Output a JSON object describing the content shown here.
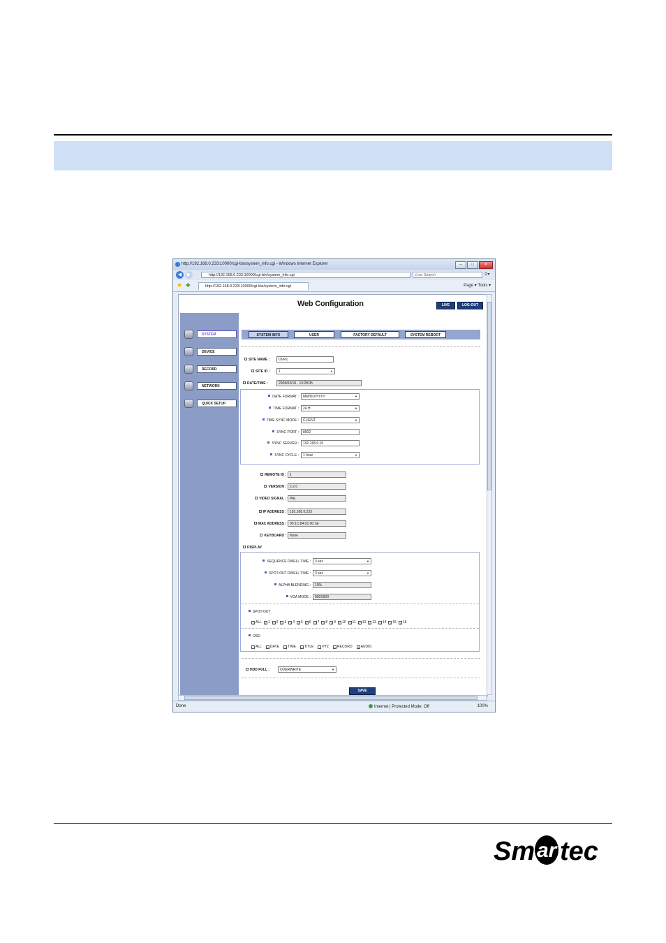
{
  "browser": {
    "title": "http://192.168.0.233:10000/cgi-bin/system_info.cgi - Windows Internet Explorer",
    "window_buttons": [
      "–",
      "□",
      "✕"
    ],
    "address": "http://192.168.0.233:10000/cgi-bin/system_info.cgi",
    "search_placeholder": "Live Search",
    "tab_title": "http://192.168.0.233:10000/cgi-bin/system_info.cgi",
    "tools_text": "Page ▾  Tools ▾",
    "status_left": "Done",
    "status_zone": "Internet | Protected Mode: Off",
    "status_zoom": "100%"
  },
  "app": {
    "title": "Web Configuration",
    "live_label": "LIVE",
    "logout_label": "LOG-OUT",
    "sidebar": [
      {
        "label": "SYSTEM",
        "active": true,
        "icon": "camera-icon"
      },
      {
        "label": "DEVICE",
        "active": false,
        "icon": "device-icon"
      },
      {
        "label": "RECORD",
        "active": false,
        "icon": "record-icon"
      },
      {
        "label": "NETWORK",
        "active": false,
        "icon": "network-icon"
      },
      {
        "label": "QUICK SETUP",
        "active": false,
        "icon": "quick-setup-icon"
      }
    ],
    "tabs": [
      "SYSTEM INFO",
      "USER",
      "FACTORY DEFAULT",
      "SYSTEM REBOOT"
    ],
    "fields": {
      "site_name": {
        "label": "SITE NAME :",
        "value": "DVR1"
      },
      "site_id": {
        "label": "SITE ID :",
        "value": "1"
      },
      "date_time": {
        "label": "DATE/TIME :",
        "value": "2008/03/18 - 13:28:05"
      },
      "date_format": {
        "label": "DATE FORMAT :",
        "value": "MM/DD/YYYY"
      },
      "time_format": {
        "label": "TIME FORMAT :",
        "value": "24 H"
      },
      "time_sync_mode": {
        "label": "TIME SYNC MODE :",
        "value": "CLIENT"
      },
      "sync_port": {
        "label": "SYNC PORT :",
        "value": "8002"
      },
      "sync_server": {
        "label": "SYNC SERVER :",
        "value": "192.168.0.15"
      },
      "sync_cycle": {
        "label": "SYNC CYCLE :",
        "value": "1 hour"
      },
      "remote_id": {
        "label": "REMOTE ID :",
        "value": "1"
      },
      "version": {
        "label": "VERSION :",
        "value": "2.2.0"
      },
      "video_signal": {
        "label": "VIDEO SIGNAL :",
        "value": "PAL"
      },
      "ip_address": {
        "label": "IP ADDRESS :",
        "value": "192.168.0.233"
      },
      "mac_address": {
        "label": "MAC ADDRESS :",
        "value": "00:1C:84:01:00:1E"
      },
      "keyboard": {
        "label": "KEYBOARD :",
        "value": "None"
      }
    },
    "display": {
      "heading": "DISPLAY",
      "sequence_dwell": {
        "label": "SEQUENCE DWELL TIME :",
        "value": "3 sec"
      },
      "spotout_dwell": {
        "label": "SPOT-OUT DWELL TIME :",
        "value": "3 sec"
      },
      "alpha_blending": {
        "label": "ALPHA BLENDING :",
        "value": "10%"
      },
      "vga_mode": {
        "label": "VGA MODE :",
        "value": "800X600"
      },
      "spotout_heading": "SPOT-OUT",
      "spotout_checks": [
        "ALL",
        "1",
        "2",
        "3",
        "4",
        "5",
        "6",
        "7",
        "8",
        "9",
        "10",
        "11",
        "12",
        "13",
        "14",
        "15",
        "16"
      ],
      "osd_heading": "OSD",
      "osd_checks": [
        {
          "label": "ALL",
          "checked": false
        },
        {
          "label": "DATE",
          "checked": true
        },
        {
          "label": "TIME",
          "checked": true
        },
        {
          "label": "TITLE",
          "checked": true
        },
        {
          "label": "PTZ",
          "checked": false
        },
        {
          "label": "RECORD",
          "checked": true
        },
        {
          "label": "AUDIO",
          "checked": true
        }
      ]
    },
    "hdd_full": {
      "label": "HDD FULL :",
      "value": "OVERWRITE"
    },
    "save_label": "SAVE"
  },
  "logo": "Smartec"
}
